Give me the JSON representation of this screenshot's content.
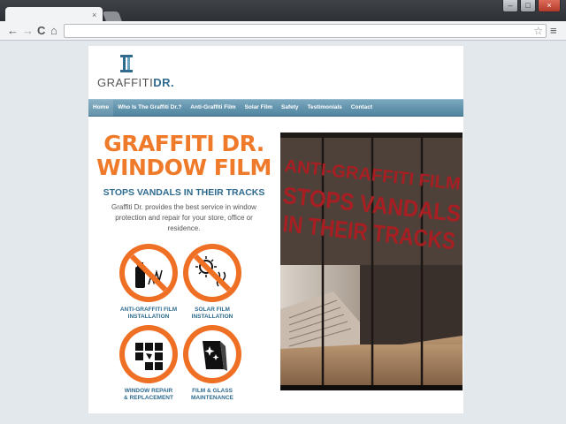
{
  "browser": {
    "tab_close": "×",
    "back_icon": "←",
    "forward_icon": "→",
    "reload_icon": "C",
    "home_icon": "⌂",
    "star_icon": "☆",
    "menu_icon": "≡",
    "window_buttons": [
      "‒",
      "□",
      "×"
    ]
  },
  "site": {
    "logo_prefix": "GRAFFITI",
    "logo_suffix": "DR.",
    "nav": [
      "Home",
      "Who Is The Graffiti Dr.?",
      "Anti-Graffiti Film",
      "Solar Film",
      "Safety",
      "Testimonials",
      "Contact"
    ],
    "hero_line1": "GRAFFITI DR.",
    "hero_line2": "WINDOW FILM",
    "tagline": "STOPS VANDALS IN THEIR TRACKS",
    "intro": "Graffiti Dr. provides the best service in window protection and repair for your store, office or residence.",
    "services": [
      {
        "line1": "ANTI-GRAFFITI FILM",
        "line2": "INSTALLATION"
      },
      {
        "line1": "SOLAR FILM",
        "line2": "INSTALLATION"
      },
      {
        "line1": "WINDOW REPAIR",
        "line2": "& REPLACEMENT"
      },
      {
        "line1": "FILM & GLASS",
        "line2": "MAINTENANCE"
      }
    ],
    "photo_text": [
      "ANTI-GRAFFITI FILM",
      "STOPS VANDALS",
      "IN THEIR TRACKS"
    ]
  },
  "colors": {
    "accent": "#ef7a2a",
    "brand": "#2e6b8f",
    "nav": "#5a8ea8",
    "photo_text": "#a81f23"
  }
}
